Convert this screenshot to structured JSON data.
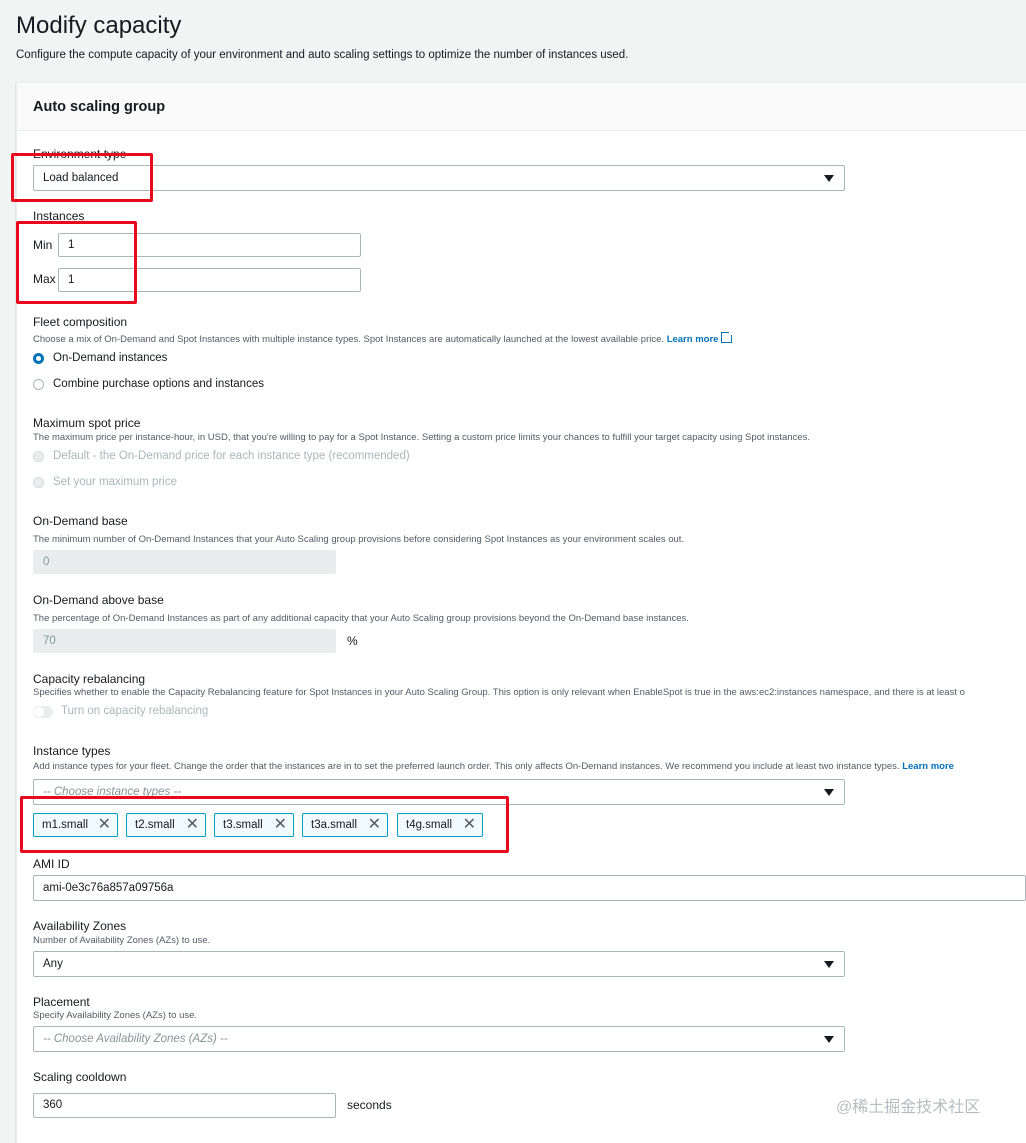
{
  "page": {
    "title": "Modify capacity",
    "description": "Configure the compute capacity of your environment and auto scaling settings to optimize the number of instances used."
  },
  "panel": {
    "title": "Auto scaling group"
  },
  "environment_type": {
    "label": "Environment type",
    "value": "Load balanced"
  },
  "instances": {
    "label": "Instances",
    "min_label": "Min",
    "min_value": "1",
    "max_label": "Max",
    "max_value": "1"
  },
  "fleet": {
    "label": "Fleet composition",
    "description": "Choose a mix of On-Demand and Spot Instances with multiple instance types. Spot Instances are automatically launched at the lowest available price.",
    "learn_more": "Learn more",
    "options": [
      "On-Demand instances",
      "Combine purchase options and instances"
    ],
    "selected": "On-Demand instances"
  },
  "spot_price": {
    "label": "Maximum spot price",
    "description": "The maximum price per instance-hour, in USD, that you're willing to pay for a Spot Instance. Setting a custom price limits your chances to fulfill your target capacity using Spot instances.",
    "options": [
      "Default - the On-Demand price for each instance type (recommended)",
      "Set your maximum price"
    ]
  },
  "ondemand_base": {
    "label": "On-Demand base",
    "description": "The minimum number of On-Demand Instances that your Auto Scaling group provisions before considering Spot Instances as your environment scales out.",
    "value": "0"
  },
  "ondemand_above": {
    "label": "On-Demand above base",
    "description": "The percentage of On-Demand Instances as part of any additional capacity that your Auto Scaling group provisions beyond the On-Demand base instances.",
    "value": "70",
    "unit": "%"
  },
  "rebalancing": {
    "label": "Capacity rebalancing",
    "description": "Specifies whether to enable the Capacity Rebalancing feature for Spot Instances in your Auto Scaling Group. This option is only relevant when EnableSpot is true in the aws:ec2:instances namespace, and there is at least o",
    "toggle_label": "Turn on capacity rebalancing"
  },
  "instance_types": {
    "label": "Instance types",
    "description": "Add instance types for your fleet. Change the order that the instances are in to set the preferred launch order. This only affects On-Demand instances. We recommend you include at least two instance types.",
    "learn_more": "Learn more",
    "placeholder": "-- Choose instance types --",
    "tokens": [
      "m1.small",
      "t2.small",
      "t3.small",
      "t3a.small",
      "t4g.small"
    ]
  },
  "ami": {
    "label": "AMI ID",
    "value": "ami-0e3c76a857a09756a"
  },
  "az": {
    "label": "Availability Zones",
    "description": "Number of Availability Zones (AZs) to use.",
    "value": "Any"
  },
  "placement": {
    "label": "Placement",
    "description": "Specify Availability Zones (AZs) to use.",
    "placeholder": "-- Choose Availability Zones (AZs) --"
  },
  "cooldown": {
    "label": "Scaling cooldown",
    "value": "360",
    "unit": "seconds"
  },
  "watermark": "@稀土掘金技术社区",
  "colors": {
    "accent": "#0073bb",
    "highlight": "#e8091e",
    "token_border": "#00a1c9"
  }
}
